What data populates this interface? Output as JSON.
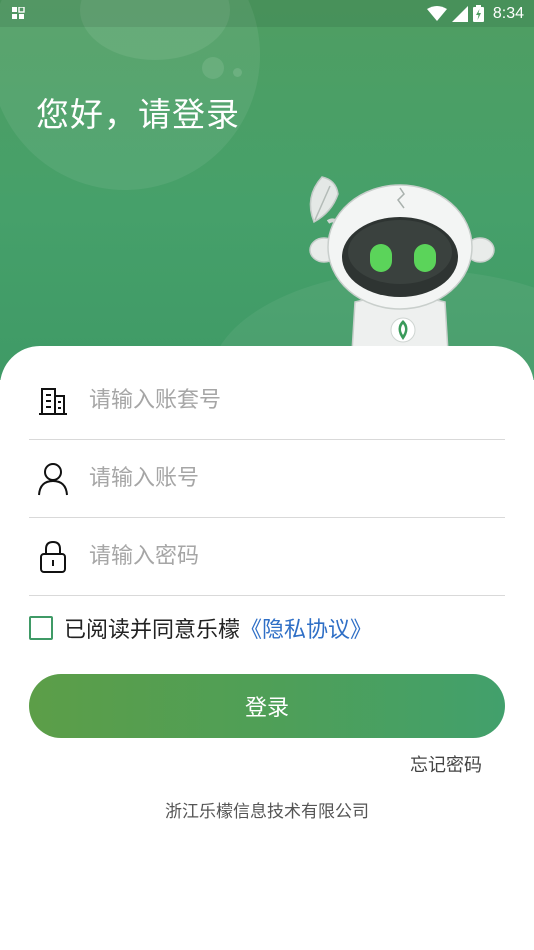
{
  "status_bar": {
    "time": "8:34",
    "icons": [
      "qr-grid-icon",
      "wifi-icon",
      "signal-icon",
      "battery-charging-icon"
    ]
  },
  "greeting": "您好，请登录",
  "form": {
    "account_set": {
      "placeholder": "请输入账套号",
      "value": "",
      "icon": "building-icon"
    },
    "account": {
      "placeholder": "请输入账号",
      "value": "",
      "icon": "user-icon"
    },
    "password": {
      "placeholder": "请输入密码",
      "value": "",
      "icon": "lock-icon"
    }
  },
  "agreement": {
    "checked": false,
    "text": "已阅读并同意乐檬",
    "link": "《隐私协议》"
  },
  "login_button": "登录",
  "forgot_password": "忘记密码",
  "company": "浙江乐檬信息技术有限公司",
  "colors": {
    "primary_green": "#46a06a",
    "button_gradient_start": "#5c9e48",
    "button_gradient_end": "#42a06c",
    "link_blue": "#2f6fc6"
  }
}
